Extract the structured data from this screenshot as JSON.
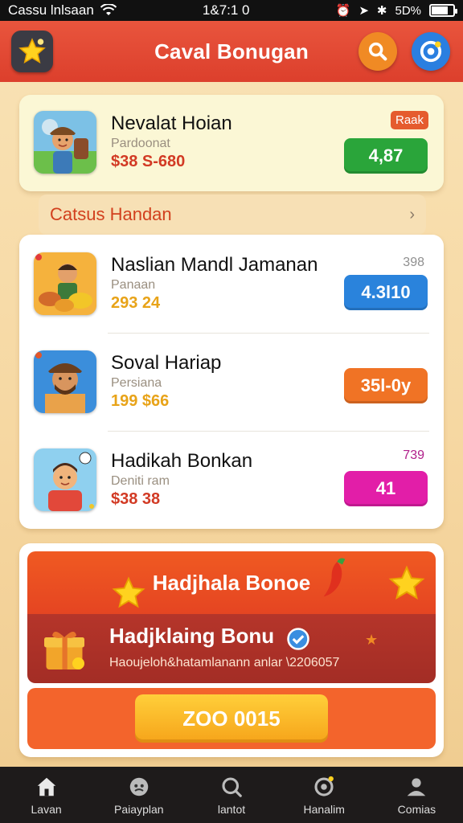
{
  "status_bar": {
    "carrier": "Cassu lnlsaan",
    "time": "1&7:1 0",
    "battery_text": "5D%"
  },
  "header": {
    "title": "Caval Bonugan"
  },
  "featured": {
    "name": "Nevalat Hoian",
    "subtitle": "Pardoonat",
    "price": "$38 S-680",
    "tag": "Raak",
    "button": "4,87",
    "button_color": "#2aa53a"
  },
  "banner": {
    "label": "Catsus Handan"
  },
  "list": [
    {
      "name": "Naslian Mandl Jamanan",
      "subtitle": "Panaan",
      "price": "293 24",
      "count": "398",
      "button": "4.3l10",
      "button_color": "#2a83dc"
    },
    {
      "name": "Soval Hariap",
      "subtitle": "Persiana",
      "price": "199 $66",
      "count": "",
      "button": "35l-0y",
      "button_color": "#f07325"
    },
    {
      "name": "Hadikah Bonkan",
      "subtitle": "Deniti ram",
      "price": "$38 38",
      "count": "739",
      "button": "41",
      "button_color": "#e21ea8"
    }
  ],
  "bonus": {
    "title": "Hadjhala Bonoe",
    "sub_title": "Hadjklaing Bonu",
    "description": "Haoujeloh&hatamlanann anlar \\2206057",
    "claim_button": "ZOO 0015"
  },
  "nav": [
    {
      "label": "Lavan",
      "icon": "home-icon"
    },
    {
      "label": "Paiayplan",
      "icon": "face-icon"
    },
    {
      "label": "lantot",
      "icon": "search-icon"
    },
    {
      "label": "Hanalim",
      "icon": "target-icon"
    },
    {
      "label": "Comias",
      "icon": "person-icon"
    }
  ]
}
